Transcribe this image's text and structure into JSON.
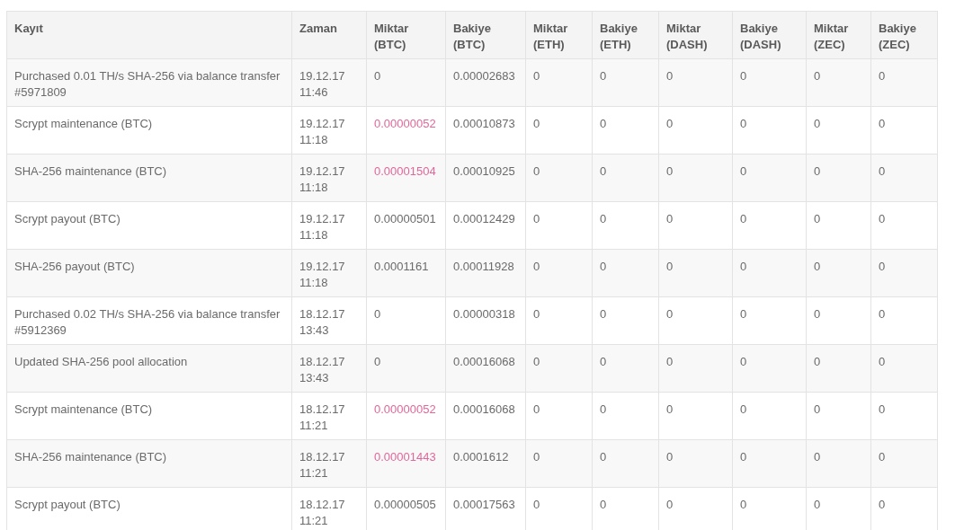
{
  "table": {
    "columns": [
      "Kayıt",
      "Zaman",
      "Miktar (BTC)",
      "Bakiye (BTC)",
      "Miktar (ETH)",
      "Bakiye (ETH)",
      "Miktar (DASH)",
      "Bakiye (DASH)",
      "Miktar (ZEC)",
      "Bakiye (ZEC)"
    ],
    "rows": [
      {
        "entry": "Purchased 0.01 TH/s SHA-256 via balance transfer #5971809",
        "time": "19.12.17 11:46",
        "amount_btc": "0",
        "debit": false,
        "values": [
          "0.00002683",
          "0",
          "0",
          "0",
          "0",
          "0",
          "0"
        ]
      },
      {
        "entry": "Scrypt maintenance (BTC)",
        "time": "19.12.17 11:18",
        "amount_btc": "0.00000052",
        "debit": true,
        "values": [
          "0.00010873",
          "0",
          "0",
          "0",
          "0",
          "0",
          "0"
        ]
      },
      {
        "entry": "SHA-256 maintenance (BTC)",
        "time": "19.12.17 11:18",
        "amount_btc": "0.00001504",
        "debit": true,
        "values": [
          "0.00010925",
          "0",
          "0",
          "0",
          "0",
          "0",
          "0"
        ]
      },
      {
        "entry": "Scrypt payout (BTC)",
        "time": "19.12.17 11:18",
        "amount_btc": "0.00000501",
        "debit": false,
        "values": [
          "0.00012429",
          "0",
          "0",
          "0",
          "0",
          "0",
          "0"
        ]
      },
      {
        "entry": "SHA-256 payout (BTC)",
        "time": "19.12.17 11:18",
        "amount_btc": "0.0001161",
        "debit": false,
        "values": [
          "0.00011928",
          "0",
          "0",
          "0",
          "0",
          "0",
          "0"
        ]
      },
      {
        "entry": "Purchased 0.02 TH/s SHA-256 via balance transfer #5912369",
        "time": "18.12.17 13:43",
        "amount_btc": "0",
        "debit": false,
        "values": [
          "0.00000318",
          "0",
          "0",
          "0",
          "0",
          "0",
          "0"
        ]
      },
      {
        "entry": "Updated SHA-256 pool allocation",
        "time": "18.12.17 13:43",
        "amount_btc": "0",
        "debit": false,
        "values": [
          "0.00016068",
          "0",
          "0",
          "0",
          "0",
          "0",
          "0"
        ]
      },
      {
        "entry": "Scrypt maintenance (BTC)",
        "time": "18.12.17 11:21",
        "amount_btc": "0.00000052",
        "debit": true,
        "values": [
          "0.00016068",
          "0",
          "0",
          "0",
          "0",
          "0",
          "0"
        ]
      },
      {
        "entry": "SHA-256 maintenance (BTC)",
        "time": "18.12.17 11:21",
        "amount_btc": "0.00001443",
        "debit": true,
        "values": [
          "0.0001612",
          "0",
          "0",
          "0",
          "0",
          "0",
          "0"
        ]
      },
      {
        "entry": "Scrypt payout (BTC)",
        "time": "18.12.17 11:21",
        "amount_btc": "0.00000505",
        "debit": false,
        "values": [
          "0.00017563",
          "0",
          "0",
          "0",
          "0",
          "0",
          "0"
        ]
      }
    ]
  }
}
